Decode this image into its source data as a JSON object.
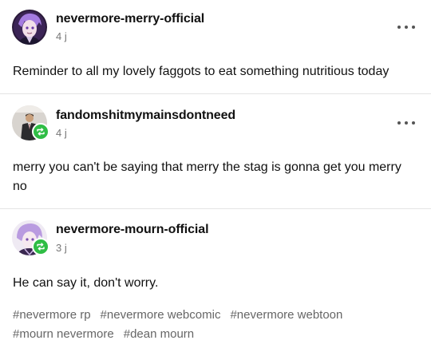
{
  "posts": [
    {
      "username": "nevermore-merry-official",
      "time": "4 j",
      "text": "Reminder to all my lovely faggots to eat something nutritious today",
      "avatar": "purple-haired-character-avatar",
      "reblog": false
    },
    {
      "username": "fandomshitmymainsdontneed",
      "time": "4 j",
      "text": "merry you can't be saying that merry the stag is gonna get you merry no",
      "avatar": "suited-man-avatar",
      "reblog": true
    },
    {
      "username": "nevermore-mourn-official",
      "time": "3 j",
      "text": "He can say it, don't worry.",
      "avatar": "lavender-haired-character-avatar",
      "reblog": true,
      "tags": [
        "#nevermore rp",
        "#nevermore webcomic",
        "#nevermore webtoon",
        "#mourn nevermore",
        "#dean mourn"
      ]
    }
  ],
  "colors": {
    "reblog_badge": "#2fbd45",
    "tag": "#666666",
    "divider": "#e4e4e4"
  },
  "icons": {
    "more": "more-options-icon",
    "reblog": "reblog-icon"
  }
}
